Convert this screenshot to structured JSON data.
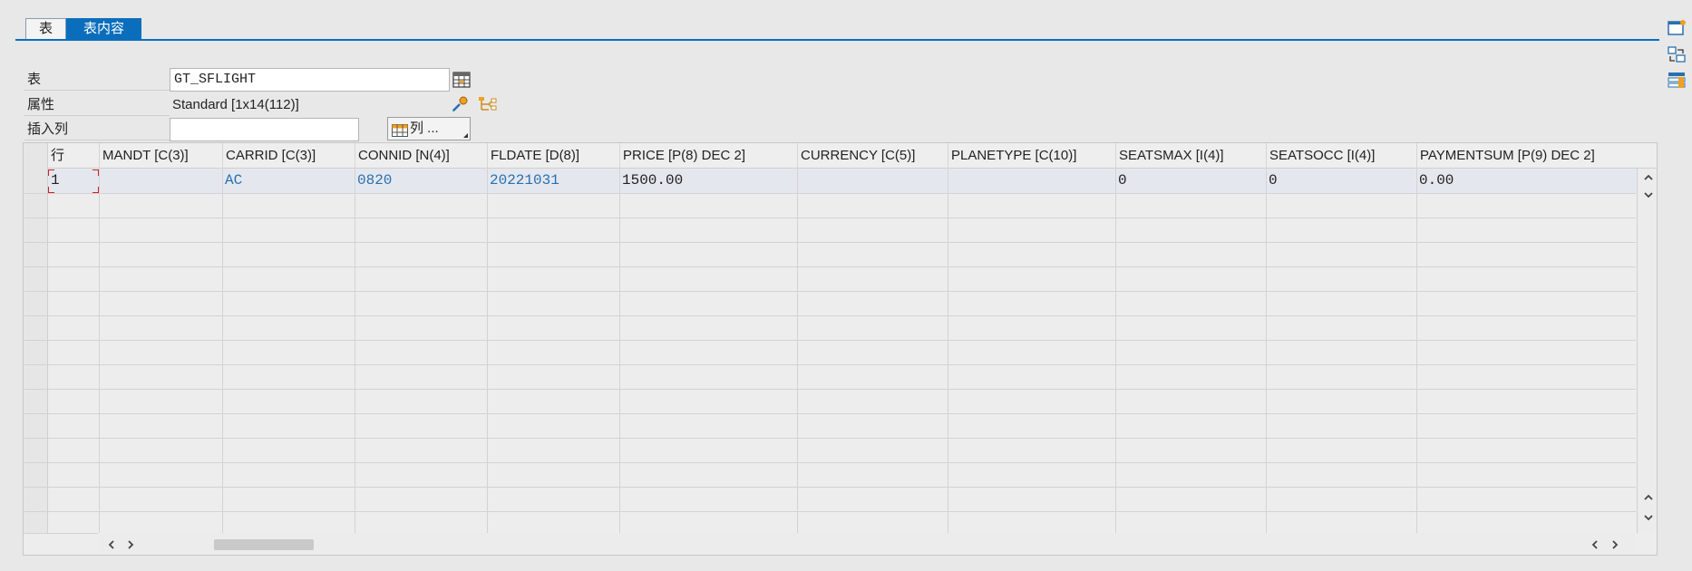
{
  "tabs": [
    {
      "label": "表"
    },
    {
      "label": "表内容"
    }
  ],
  "form": {
    "table_label": "表",
    "table_value": "GT_SFLIGHT",
    "attr_label": "属性",
    "attr_value": "Standard [1x14(112)]",
    "insert_label": "插入列",
    "insert_value": "",
    "columns_button": "列 ..."
  },
  "grid": {
    "row_header": "行",
    "columns": [
      "MANDT [C(3)]",
      "CARRID [C(3)]",
      "CONNID [N(4)]",
      "FLDATE [D(8)]",
      "PRICE [P(8) DEC 2]",
      "CURRENCY [C(5)]",
      "PLANETYPE [C(10)]",
      "SEATSMAX [I(4)]",
      "SEATSOCC [I(4)]",
      "PAYMENTSUM [P(9) DEC 2]"
    ],
    "rows": [
      {
        "row": "1",
        "mandt": "",
        "carrid": "AC",
        "connid": "0820",
        "fldate": "20221031",
        "price": "1500.00",
        "currency": "",
        "planetype": "",
        "seatsmax": "0",
        "seatsocc": "0",
        "paymentsum": "0.00"
      }
    ]
  },
  "colors": {
    "accent": "#0a6ebd",
    "link": "#2a6fb0",
    "focus": "#d02020"
  }
}
